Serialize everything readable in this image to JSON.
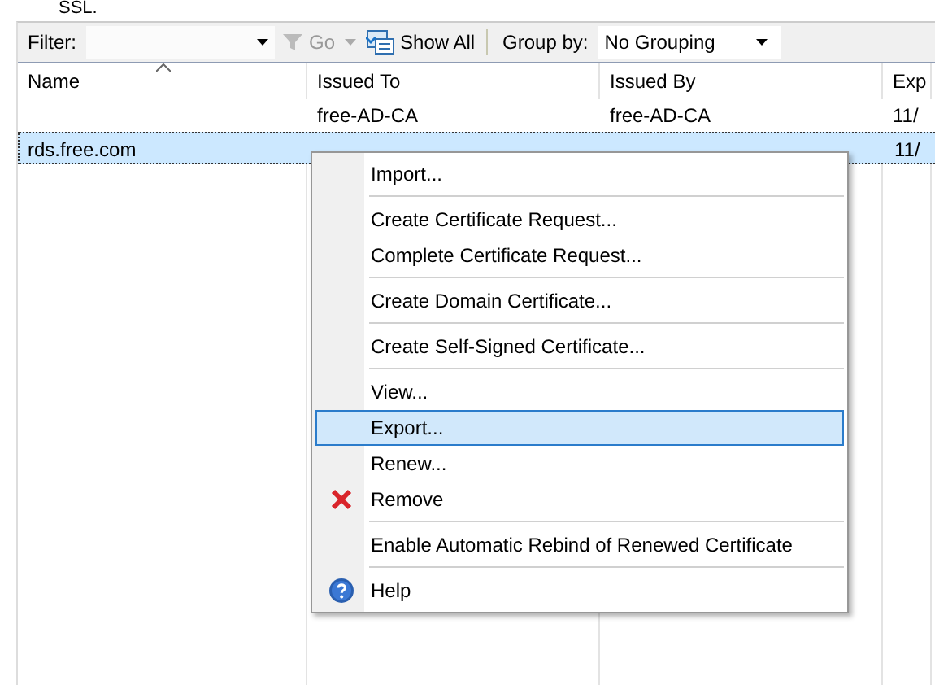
{
  "heading": "SSL.",
  "toolbar": {
    "filter_label": "Filter:",
    "go_label": "Go",
    "go_disabled": true,
    "show_all_label": "Show All",
    "group_by_label": "Group by:",
    "group_by_value": "No Grouping"
  },
  "table": {
    "columns": [
      {
        "label": "Name",
        "sorted": true
      },
      {
        "label": "Issued To",
        "sorted": false
      },
      {
        "label": "Issued By",
        "sorted": false
      },
      {
        "label": "Exp",
        "sorted": false
      }
    ],
    "rows": [
      {
        "issued_to": "free-AD-CA",
        "issued_by": "free-AD-CA",
        "column_4": "11/",
        "selected": false
      },
      {
        "name": "rds.free.com",
        "column_4": "11/",
        "selected": true
      }
    ]
  },
  "context_menu": [
    {
      "kind": "item",
      "label": "Import...",
      "selected": false
    },
    {
      "kind": "separator"
    },
    {
      "kind": "item",
      "label": "Create Certificate Request...",
      "selected": false
    },
    {
      "kind": "item",
      "label": "Complete Certificate Request...",
      "selected": false
    },
    {
      "kind": "separator"
    },
    {
      "kind": "item",
      "label": "Create Domain Certificate...",
      "selected": false
    },
    {
      "kind": "separator"
    },
    {
      "kind": "item",
      "label": "Create Self-Signed Certificate...",
      "selected": false
    },
    {
      "kind": "separator"
    },
    {
      "kind": "item",
      "label": "View...",
      "selected": false
    },
    {
      "kind": "item",
      "label": "Export...",
      "selected": true
    },
    {
      "kind": "item",
      "label": "Renew...",
      "selected": false
    },
    {
      "kind": "remove",
      "label": "Remove",
      "selected": false
    },
    {
      "kind": "separator"
    },
    {
      "kind": "item",
      "label": "Enable Automatic Rebind of Renewed Certificate",
      "selected": false
    },
    {
      "kind": "separator"
    },
    {
      "kind": "help",
      "label": "Help",
      "selected": false
    }
  ]
}
